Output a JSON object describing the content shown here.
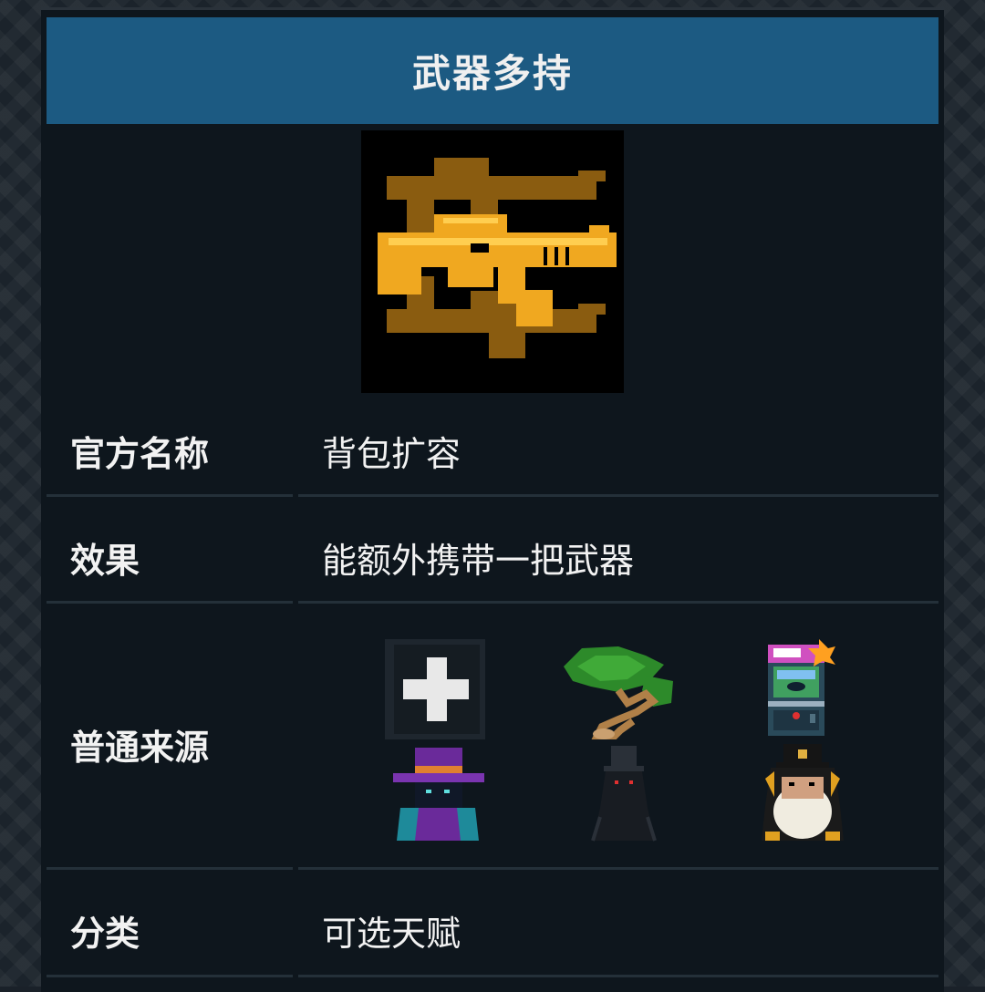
{
  "header": {
    "title": "武器多持"
  },
  "talent_icon": {
    "name": "multi-weapon-icon"
  },
  "rows": [
    {
      "label": "官方名称",
      "value": "背包扩容"
    },
    {
      "label": "效果",
      "value": "能额外携带一把武器"
    },
    {
      "label": "普通来源",
      "value": ""
    },
    {
      "label": "分类",
      "value": "可选天赋"
    }
  ],
  "sources": [
    {
      "name": "plus-icon"
    },
    {
      "name": "bonsai-tree-icon"
    },
    {
      "name": "arcade-machine-icon"
    },
    {
      "name": "wizard-merchant-icon"
    },
    {
      "name": "shadow-figure-icon"
    },
    {
      "name": "penguin-gentleman-icon"
    }
  ],
  "colors": {
    "header_bg": "#1c5a82",
    "panel_bg": "#0e161d",
    "gold": "#f0b020",
    "text": "#f2f2f2"
  }
}
